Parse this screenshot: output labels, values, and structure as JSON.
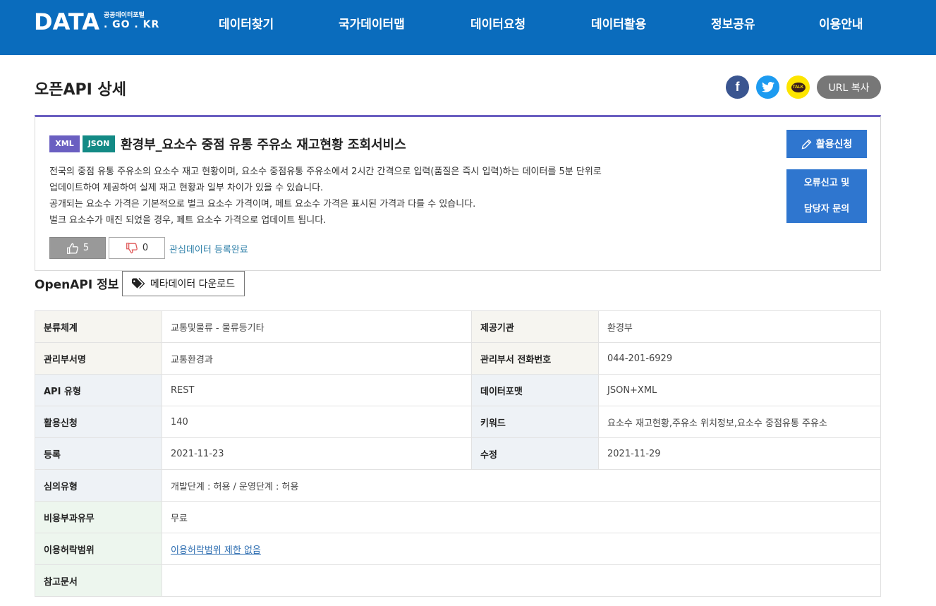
{
  "header": {
    "logo_main": "DATA",
    "logo_sub_top": "공공데이터포털",
    "logo_sub_bottom": ". GO . KR",
    "nav": [
      "데이터찾기",
      "국가데이터맵",
      "데이터요청",
      "데이터활용",
      "정보공유",
      "이용안내"
    ]
  },
  "page": {
    "title": "오픈API 상세",
    "share": {
      "facebook_icon": "f",
      "twitter_icon": "t",
      "kakao_icon": "TALK",
      "url_copy": "URL 복사"
    }
  },
  "summary": {
    "badges": [
      "XML",
      "JSON"
    ],
    "api_title": "환경부_요소수 중점 유통 주유소 재고현황 조회서비스",
    "description": [
      "전국의 중점 유통 주유소의 요소수 재고 현황이며, 요소수 중점유통 주유소에서 2시간 간격으로 입력(품질은 즉시 입력)하는 데이터를 5분 단위로",
      "업데이트하여 제공하여 실제 재고 현황과 일부 차이가 있을 수 있습니다.",
      "공개되는 요소수 가격은 기본적으로 벌크 요소수 가격이며, 페트 요소수 가격은 표시된 가격과 다를 수 있습니다.",
      "벌크 요소수가 매진 되었을 경우, 페트 요소수 가격으로 업데이트 됩니다."
    ],
    "likes": "5",
    "dislikes": "0",
    "favorite_link": "관심데이터 등록완료",
    "apply_label": "활용신청",
    "report_line1": "오류신고 및",
    "report_line2": "담당자 문의"
  },
  "info": {
    "section_title": "OpenAPI 정보",
    "meta_download": "메타데이터 다운로드",
    "rows": {
      "category_label": "분류체계",
      "category": "교통및물류 - 물류등기타",
      "provider_label": "제공기관",
      "provider": "환경부",
      "dept_label": "관리부서명",
      "dept": "교통환경과",
      "phone_label": "관리부서 전화번호",
      "phone": "044-201-6929",
      "apitype_label": "API 유형",
      "apitype": "REST",
      "format_label": "데이터포맷",
      "format": "JSON+XML",
      "apply_label": "활용신청",
      "apply": "140",
      "keyword_label": "키워드",
      "keyword": "요소수 재고현황,주유소 위치정보,요소수 중점유통 주유소",
      "reg_label": "등록",
      "reg": "2021-11-23",
      "mod_label": "수정",
      "mod": "2021-11-29",
      "review_label": "심의유형",
      "review": "개발단계 : 허용 / 운영단계 : 허용",
      "cost_label": "비용부과유무",
      "cost": "무료",
      "license_label": "이용허락범위",
      "license": "이용허락범위 제한 없음",
      "ref_label": "참고문서",
      "ref": ""
    }
  },
  "colors": {
    "header_bg": "#0a6cbd",
    "accent_purple": "#6a5fc1",
    "json_teal": "#138a85",
    "button_blue": "#2f76cf"
  }
}
